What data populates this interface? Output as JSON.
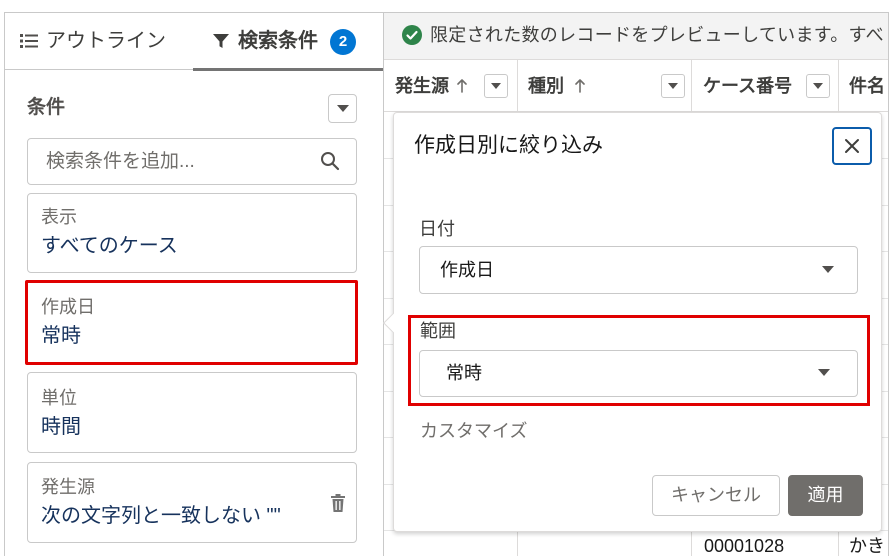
{
  "left_panel": {
    "tabs": [
      {
        "label": "アウトライン",
        "icon": "list-icon",
        "active": false
      },
      {
        "label": "検索条件",
        "icon": "filter-icon",
        "active": true,
        "badge": "2"
      }
    ],
    "filters_heading": "条件",
    "filters_menu_icon": "chevron-down-icon",
    "search_placeholder": "検索条件を追加...",
    "search_icon": "search-icon",
    "filter_cards": [
      {
        "label": "表示",
        "value": "すべてのケース"
      },
      {
        "label": "作成日",
        "value": "常時"
      },
      {
        "label": "単位",
        "value": "時間"
      },
      {
        "label": "発生源",
        "value": "次の文字列と一致しない \"\"",
        "icon": "trash-icon"
      }
    ]
  },
  "preview_banner": {
    "icon": "success-check-icon",
    "text": "限定された数のレコードをプレビューしています。すべ"
  },
  "table": {
    "columns": [
      {
        "label": "発生源",
        "sort_icon": "sort-ascending-icon",
        "menu_icon": "chevron-down-icon"
      },
      {
        "label": "種別",
        "sort_icon": "sort-ascending-icon",
        "menu_icon": "chevron-down-icon"
      },
      {
        "label": "ケース番号",
        "menu_icon": "chevron-down-icon"
      },
      {
        "label": "件名"
      }
    ],
    "visible_rows": [
      {
        "case_number": "00001028",
        "subject": "かき"
      }
    ]
  },
  "popover": {
    "title": "作成日別に絞り込み",
    "close_icon": "close-icon",
    "date_label": "日付",
    "date_value": "作成日",
    "range_label": "範囲",
    "range_value": "常時",
    "customize_label": "カスタマイズ",
    "cancel_label": "キャンセル",
    "apply_label": "適用"
  },
  "colors": {
    "accent": "#0176d3",
    "success": "#2e844a",
    "annotation_red": "#e00000",
    "filter_value_text": "#16325c",
    "apply_button": "#706e6b",
    "close_focus_ring": "#0b5cab"
  }
}
